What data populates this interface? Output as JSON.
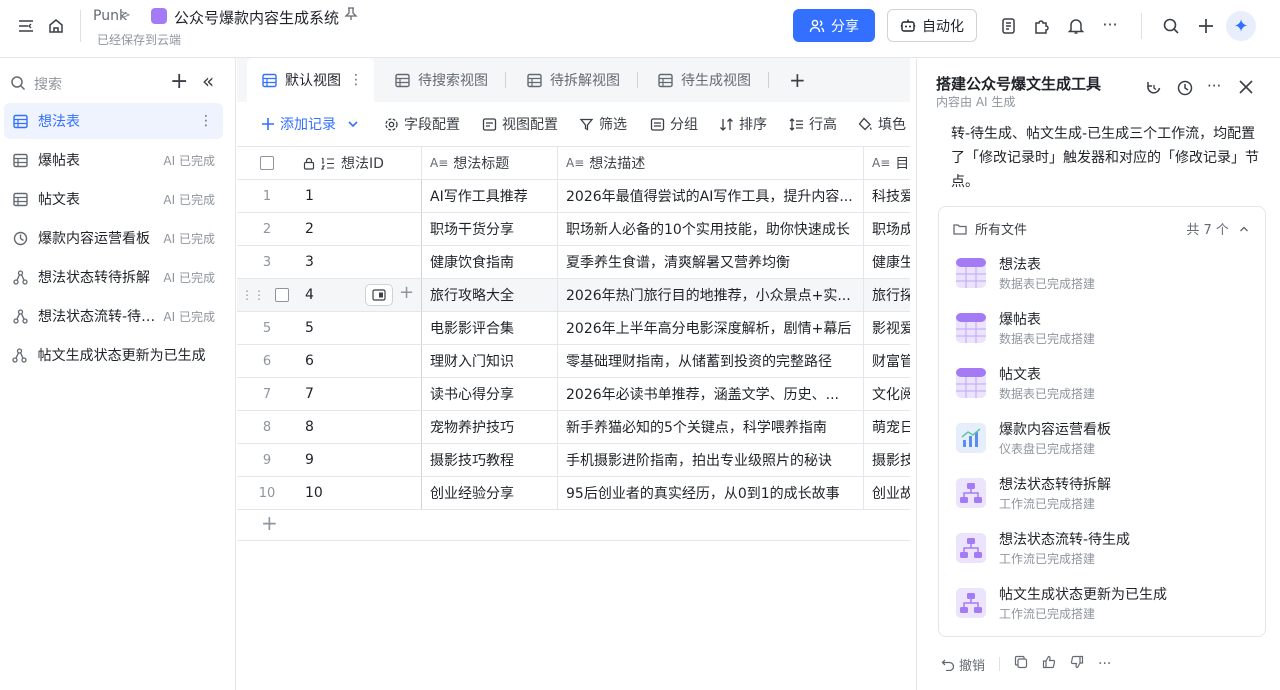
{
  "header": {
    "app_name": "Punk",
    "separator": ">",
    "doc_title": "公众号爆款内容生成系统",
    "saved_status": "已经保存到云端",
    "share_label": "分享",
    "automation_label": "自动化",
    "more_label": "···",
    "add_label": "+"
  },
  "sidebar": {
    "search_placeholder": "搜索",
    "add_label": "+",
    "collapse_label": "«",
    "items": [
      {
        "label": "想法表",
        "badge": "",
        "icon": "table-icon"
      },
      {
        "label": "爆帖表",
        "badge": "AI 已完成",
        "icon": "table-icon"
      },
      {
        "label": "帖文表",
        "badge": "AI 已完成",
        "icon": "table-icon"
      },
      {
        "label": "爆款内容运营看板",
        "badge": "AI 已完成",
        "icon": "dashboard-icon"
      },
      {
        "label": "想法状态转待拆解",
        "badge": "AI 已完成",
        "icon": "workflow-icon"
      },
      {
        "label": "想法状态流转-待生成",
        "badge": "AI 已完成",
        "icon": "workflow-icon"
      },
      {
        "label": "帖文生成状态更新为已生成",
        "badge": "",
        "icon": "workflow-icon"
      }
    ]
  },
  "tabs": [
    {
      "label": "默认视图"
    },
    {
      "label": "待搜索视图"
    },
    {
      "label": "待拆解视图"
    },
    {
      "label": "待生成视图"
    }
  ],
  "tab_more": "⋮",
  "tab_add": "+",
  "toolbar": {
    "add_record": "添加记录",
    "field_config": "字段配置",
    "view_config": "视图配置",
    "filter": "筛选",
    "group": "分组",
    "sort": "排序",
    "row_height": "行高",
    "fill": "填色"
  },
  "grid": {
    "columns": [
      "想法ID",
      "想法标题",
      "想法描述",
      "目标"
    ],
    "column_type_glyph": "A≡",
    "add_row_label": "+",
    "rows": [
      {
        "num": "1",
        "id": "1",
        "title": "AI写作工具推荐",
        "desc": "2026年最值得尝试的AI写作工具，提升内容...",
        "target": "科技爱"
      },
      {
        "num": "2",
        "id": "2",
        "title": "职场干货分享",
        "desc": "职场新人必备的10个实用技能，助你快速成长",
        "target": "职场成"
      },
      {
        "num": "3",
        "id": "3",
        "title": "健康饮食指南",
        "desc": "夏季养生食谱，清爽解暑又营养均衡",
        "target": "健康生"
      },
      {
        "num": "",
        "id": "4",
        "title": "旅行攻略大全",
        "desc": "2026年热门旅行目的地推荐，小众景点+实...",
        "target": "旅行探"
      },
      {
        "num": "5",
        "id": "5",
        "title": "电影影评合集",
        "desc": "2026年上半年高分电影深度解析，剧情+幕后",
        "target": "影视爱"
      },
      {
        "num": "6",
        "id": "6",
        "title": "理财入门知识",
        "desc": "零基础理财指南，从储蓄到投资的完整路径",
        "target": "财富管"
      },
      {
        "num": "7",
        "id": "7",
        "title": "读书心得分享",
        "desc": "2026年必读书单推荐，涵盖文学、历史、...",
        "target": "文化阅"
      },
      {
        "num": "8",
        "id": "8",
        "title": "宠物养护技巧",
        "desc": "新手养猫必知的5个关键点，科学喂养指南",
        "target": "萌宠日"
      },
      {
        "num": "9",
        "id": "9",
        "title": "摄影技巧教程",
        "desc": "手机摄影进阶指南，拍出专业级照片的秘诀",
        "target": "摄影技"
      },
      {
        "num": "10",
        "id": "10",
        "title": "创业经验分享",
        "desc": "95后创业者的真实经历，从0到1的成长故事",
        "target": "创业故"
      }
    ]
  },
  "panel": {
    "title": "搭建公众号爆文生成工具",
    "subtitle": "内容由 AI 生成",
    "message": "转-待生成、帖文生成-已生成三个工作流，均配置了「修改记录时」触发器和对应的「修改记录」节点。",
    "files_header": "所有文件",
    "files_count": "共 7 个",
    "files": [
      {
        "name": "想法表",
        "desc": "数据表已完成搭建",
        "kind": "table"
      },
      {
        "name": "爆帖表",
        "desc": "数据表已完成搭建",
        "kind": "table"
      },
      {
        "name": "帖文表",
        "desc": "数据表已完成搭建",
        "kind": "table"
      },
      {
        "name": "爆款内容运营看板",
        "desc": "仪表盘已完成搭建",
        "kind": "dashboard"
      },
      {
        "name": "想法状态转待拆解",
        "desc": "工作流已完成搭建",
        "kind": "workflow"
      },
      {
        "name": "想法状态流转-待生成",
        "desc": "工作流已完成搭建",
        "kind": "workflow"
      },
      {
        "name": "帖文生成状态更新为已生成",
        "desc": "工作流已完成搭建",
        "kind": "workflow"
      }
    ],
    "undo_label": "撤销",
    "more_label": "···"
  },
  "colors": {
    "accent": "#3370ff",
    "active_bg": "#eef3fe",
    "table_icon": "#a47bf5",
    "dashboard_icon": "#5b8def"
  }
}
